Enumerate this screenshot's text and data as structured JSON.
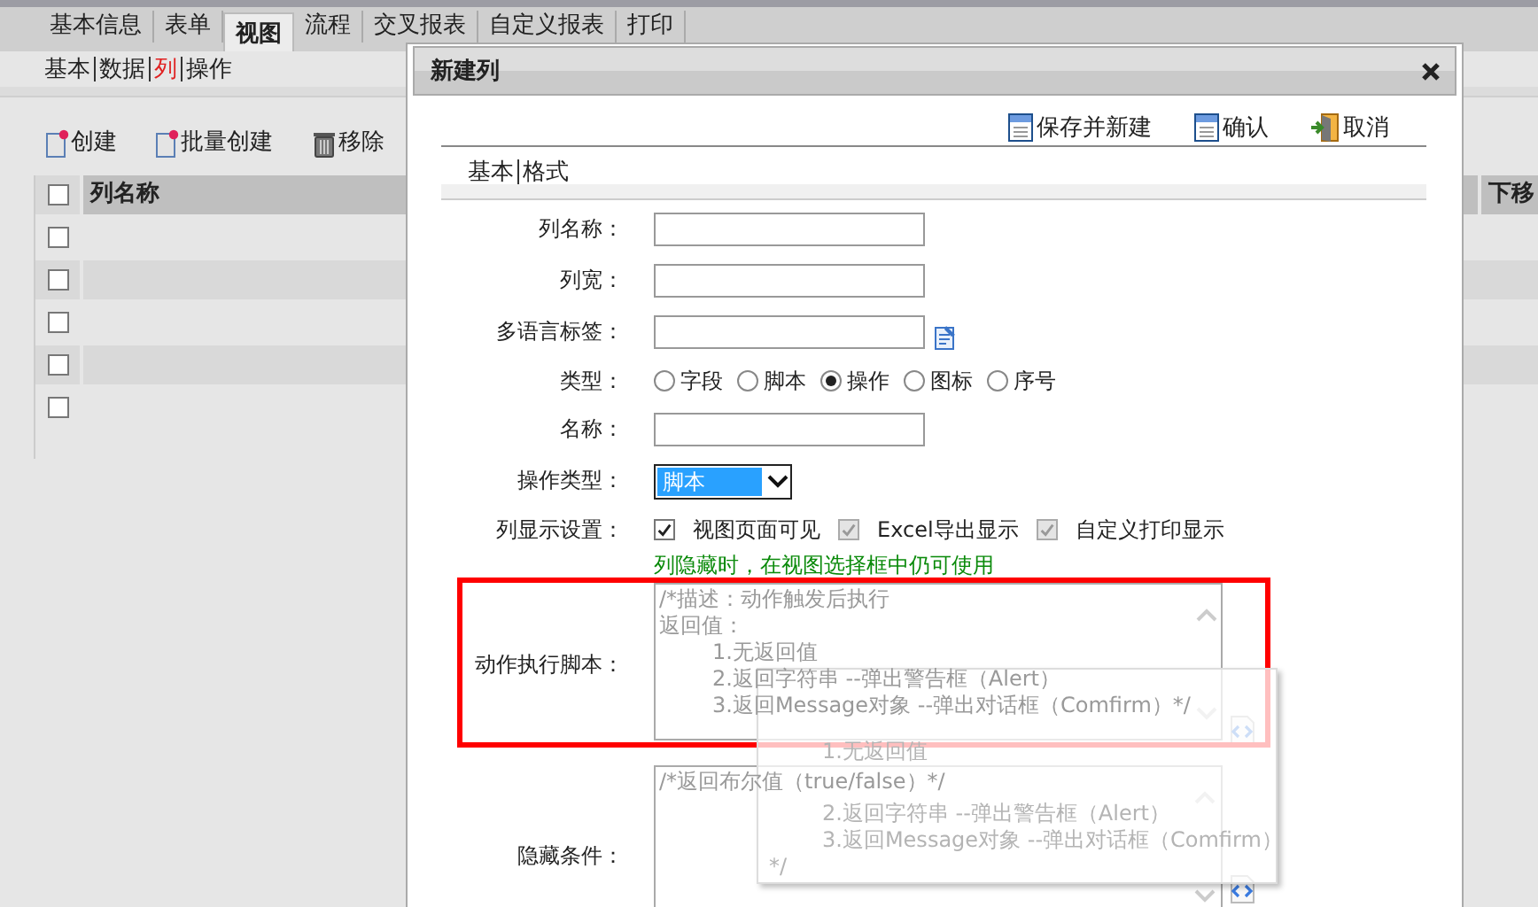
{
  "main_tabs": [
    {
      "label": "基本信息",
      "selected": false
    },
    {
      "label": "表单",
      "selected": false
    },
    {
      "label": "视图",
      "selected": true
    },
    {
      "label": "流程",
      "selected": false
    },
    {
      "label": "交叉报表",
      "selected": false
    },
    {
      "label": "自定义报表",
      "selected": false
    },
    {
      "label": "打印",
      "selected": false
    }
  ],
  "sub_tabs": [
    {
      "label": "基本",
      "selected": false
    },
    {
      "label": "数据",
      "selected": false
    },
    {
      "label": "列",
      "selected": true
    },
    {
      "label": "操作",
      "selected": false
    }
  ],
  "toolbar": [
    {
      "label": "创建",
      "kind": "new"
    },
    {
      "label": "批量创建",
      "kind": "new"
    },
    {
      "label": "移除",
      "kind": "delete"
    }
  ],
  "table": {
    "header_checked": false,
    "columns": [
      "列名称",
      "下移"
    ],
    "rows": [
      {
        "checked": false
      },
      {
        "checked": false
      },
      {
        "checked": false
      },
      {
        "checked": false
      },
      {
        "checked": false
      }
    ]
  },
  "dialog": {
    "title": "新建列",
    "actions": [
      {
        "label": "保存并新建",
        "kind": "save"
      },
      {
        "label": "确认",
        "kind": "save"
      },
      {
        "label": "取消",
        "kind": "exit"
      }
    ],
    "tabs": [
      "基本",
      "格式"
    ],
    "fields": [
      {
        "kind": "text",
        "label": "列名称："
      },
      {
        "kind": "text",
        "label": "列宽："
      },
      {
        "kind": "text_lang",
        "label": "多语言标签："
      },
      {
        "kind": "radio",
        "label": "类型：",
        "options": [
          {
            "label": "字段",
            "selected": false
          },
          {
            "label": "脚本",
            "selected": false
          },
          {
            "label": "操作",
            "selected": true
          },
          {
            "label": "图标",
            "selected": false
          },
          {
            "label": "序号",
            "selected": false
          }
        ]
      },
      {
        "kind": "text",
        "label": "名称："
      },
      {
        "kind": "select",
        "label": "操作类型：",
        "value": "脚本"
      },
      {
        "kind": "checks",
        "label": "列显示设置：",
        "options": [
          {
            "label": "视图页面可见",
            "checked": true,
            "disabled": false
          },
          {
            "label": "Excel导出显示",
            "checked": true,
            "disabled": true
          },
          {
            "label": "自定义打印显示",
            "checked": true,
            "disabled": true
          }
        ],
        "hint": "列隐藏时，在视图选择框中仍可使用"
      },
      {
        "kind": "script",
        "label": "动作执行脚本：",
        "highlighted": true,
        "lines": [
          {
            "text": "/*描述：动作触发后执行",
            "indented": false
          },
          {
            "text": "返回值：",
            "indented": false
          },
          {
            "text": "1.无返回值",
            "indented": true
          },
          {
            "text": "2.返回字符串       --弹出警告框（Alert）",
            "indented": true
          },
          {
            "text": "3.返回Message对象  --弹出对话框（Comfirm）*/",
            "indented": true
          }
        ]
      },
      {
        "kind": "script",
        "label": "隐藏条件：",
        "highlighted": false,
        "lines": [
          {
            "text": "/*返回布尔值（true/false）*/",
            "indented": false
          }
        ]
      }
    ]
  },
  "tooltip": {
    "lines": [
      {
        "text": "1.无返回值",
        "indented": true
      },
      {
        "text": "2.返回字符串        --弹出警告框（Alert）",
        "indented": true
      },
      {
        "text": "3.返回Message对象 --弹出对话框（Comfirm）",
        "indented": true
      },
      {
        "text": "*/",
        "indented": false
      }
    ]
  }
}
